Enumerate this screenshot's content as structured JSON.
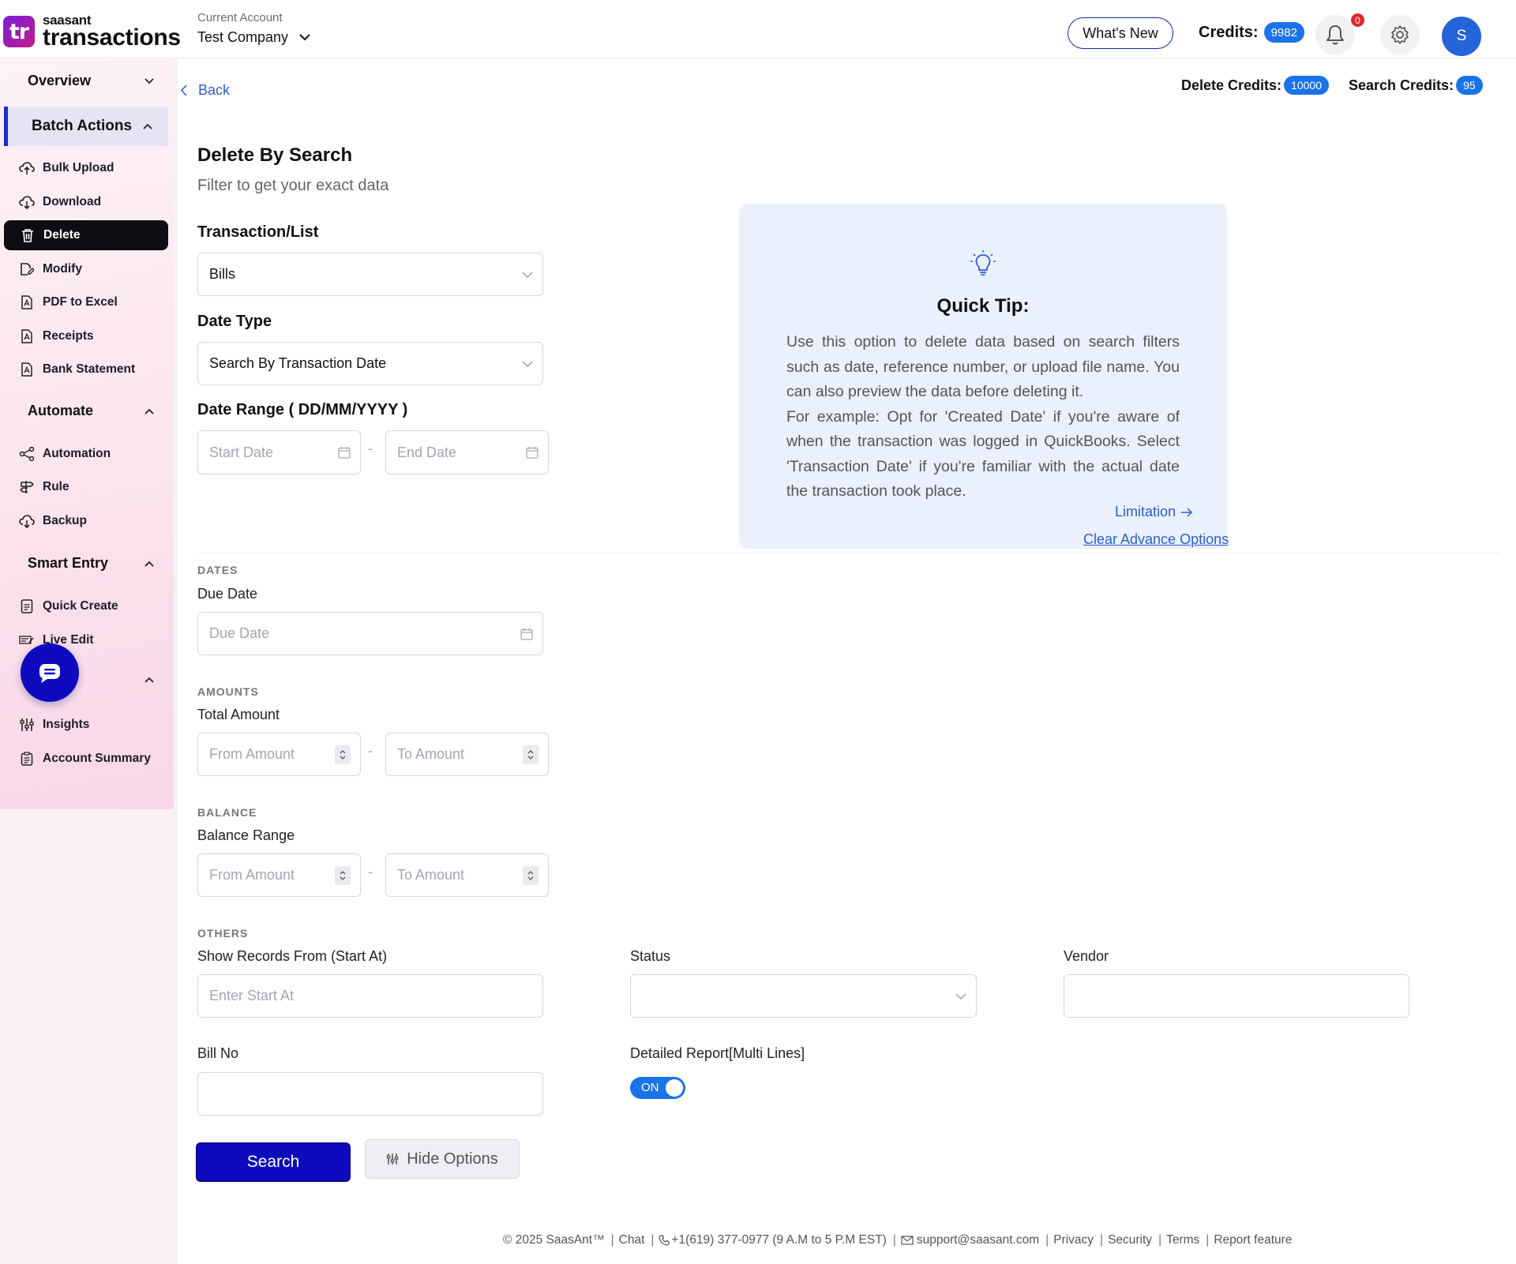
{
  "header": {
    "logo_sub": "saasant",
    "logo_main": "transactions",
    "logo_mark": "tr",
    "account_label": "Current Account",
    "account_value": "Test Company",
    "whats_new": "What's New",
    "credits_label": "Credits:",
    "credits_value": "9982",
    "notifications_count": "0",
    "avatar_initial": "S"
  },
  "sidebar": {
    "overview": "Overview",
    "batch_actions": "Batch Actions",
    "batch_items": [
      "Bulk Upload",
      "Download",
      "Delete",
      "Modify",
      "PDF to Excel",
      "Receipts",
      "Bank Statement"
    ],
    "automate": "Automate",
    "automate_items": [
      "Automation",
      "Rule",
      "Backup"
    ],
    "smart_entry": "Smart Entry",
    "smart_entry_items": [
      "Quick Create",
      "Live Edit"
    ],
    "reports_items": [
      "Insights",
      "Account Summary"
    ],
    "icons": {
      "bulk_upload": "cloud-upload-icon",
      "download": "cloud-download-icon",
      "delete": "trash-icon",
      "modify": "edit-file-icon",
      "pdf": "pdf-file-icon",
      "receipts": "receipt-file-icon",
      "bank": "bank-file-icon",
      "automation": "share-nodes-icon",
      "rule": "signpost-icon",
      "backup": "cloud-backup-icon",
      "quick_create": "document-icon",
      "live_edit": "pencil-table-icon",
      "insights": "sliders-icon",
      "account_summary": "clipboard-icon",
      "chat": "chat-bubble-icon"
    }
  },
  "main": {
    "back": "Back",
    "delete_credits_label": "Delete Credits:",
    "delete_credits_value": "10000",
    "search_credits_label": "Search Credits:",
    "search_credits_value": "95",
    "title": "Delete By Search",
    "subtitle": "Filter to get your exact data",
    "transaction_label": "Transaction/List",
    "transaction_value": "Bills",
    "date_type_label": "Date Type",
    "date_type_value": "Search By Transaction Date",
    "date_range_label": "Date Range ( DD/MM/YYYY )",
    "start_date_placeholder": "Start Date",
    "end_date_placeholder": "End Date",
    "range_dash": "-",
    "tip": {
      "title": "Quick Tip:",
      "line1": "Use this option to delete data based on search filters such as date, reference number, or upload file name. You can also preview the data before deleting it.",
      "line2": "For example: Opt for 'Created Date' if you're aware of when the transaction was logged in QuickBooks. Select 'Transaction Date' if you're familiar with the actual date the transaction took place.",
      "limitation": "Limitation"
    },
    "clear_advance": "Clear Advance Options",
    "dates_caption": "DATES",
    "due_date_label": "Due Date",
    "due_date_placeholder": "Due Date",
    "amounts_caption": "AMOUNTS",
    "total_amount_label": "Total Amount",
    "from_amount_placeholder": "From Amount",
    "to_amount_placeholder": "To Amount",
    "balance_caption": "BALANCE",
    "balance_range_label": "Balance Range",
    "others_caption": "OTHERS",
    "start_at_label": "Show Records From (Start At)",
    "start_at_placeholder": "Enter Start At",
    "status_label": "Status",
    "status_value": "",
    "vendor_label": "Vendor",
    "vendor_value": "",
    "bill_no_label": "Bill No",
    "bill_no_value": "",
    "detailed_report_label": "Detailed Report[Multi Lines]",
    "toggle_state": "ON",
    "search_button": "Search",
    "hide_options_button": "Hide Options"
  },
  "footer": {
    "copyright": "© 2025 SaasAnt™",
    "chat": "Chat",
    "phone": "+1(619) 377-0977 (9 A.M to 5 P.M EST)",
    "email": "support@saasant.com",
    "privacy": "Privacy",
    "security": "Security",
    "terms": "Terms",
    "report": "Report feature"
  },
  "colors": {
    "accent": "#1a73e8",
    "primary_button": "#0d0bbd",
    "link": "#2a60d0",
    "active_nav": "#0d0d12"
  }
}
